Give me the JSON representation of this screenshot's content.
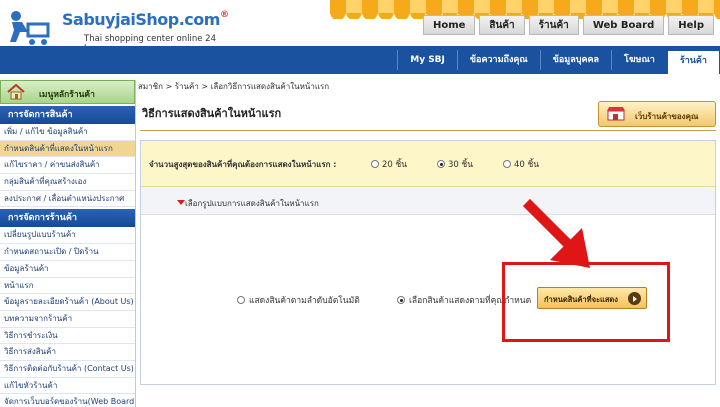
{
  "header": {
    "logo_text": "SabuyjaiShop.com",
    "logo_mark": "®",
    "tagline": "Thai shopping center online 24 hr.",
    "top_nav": [
      "Home",
      "สินค้า",
      "ร้านค้า",
      "Web Board",
      "Help"
    ],
    "sub_nav": [
      "My SBJ",
      "ข้อความถึงคุณ",
      "ข้อมูลบุคคล",
      "โฆษณา",
      "ร้านค้า"
    ]
  },
  "sidebar": {
    "home_label": "เมนูหลักร้านค้า",
    "section1": "การจัดการสินค้า",
    "items1": [
      "เพิ่ม / แก้ไข ข้อมูลสินค้า",
      "กำหนดสินค้าที่แสดงในหน้าแรก",
      "แก้ไขราคา / ค่าขนส่งสินค้า",
      "กลุ่มสินค้าที่คุณสร้างเอง",
      "ลงประกาศ / เลื่อนตำแหน่งประกาศ"
    ],
    "section2": "การจัดการร้านค้า",
    "items2": [
      "เปลี่ยนรูปแบบร้านค้า",
      "กำหนดสถานะเปิด / ปิดร้าน",
      "ข้อมูลร้านค้า",
      "หน้าแรก",
      "ข้อมูลรายละเอียดร้านค้า (About Us)",
      "บทความจากร้านค้า",
      "วิธีการชำระเงิน",
      "วิธีการส่งสินค้า",
      "วิธีการติดต่อกับร้านค้า (Contact Us)",
      "แก้ไขหัวร้านค้า",
      "จัดการเว็บบอร์ดของร้าน(Web Board)"
    ]
  },
  "main": {
    "breadcrumb": "สมาชิก > ร้านค้า > เลือกวิธีการแสดงสินค้าในหน้าแรก",
    "title": "วิธีการแสดงสินค้าในหน้าแรก",
    "shop_button": "เว็บร้านค้าของคุณ",
    "max_question": "จำนวนสูงสุดของสินค้าที่คุณต้องการแสดงในหน้าแรก :",
    "max_options": [
      "20 ชิ้น",
      "30 ชิ้น",
      "40 ชิ้น"
    ],
    "max_selected": "30 ชิ้น",
    "section_label": "เลือกรูปแบบการแสดงสินค้าในหน้าแรก",
    "display_options": [
      "แสดงสินค้าตามลำดับอัตโนมัติ",
      "เลือกสินค้าแสดงตามที่คุณกำหนด"
    ],
    "display_selected": "เลือกสินค้าแสดงตามที่คุณกำหนด",
    "define_button": "กำหนดสินค้าที่จะแสดง"
  },
  "colors": {
    "brand_blue": "#1a52a0",
    "highlight_red": "#e01515",
    "accent_orange": "#f5c25c"
  }
}
